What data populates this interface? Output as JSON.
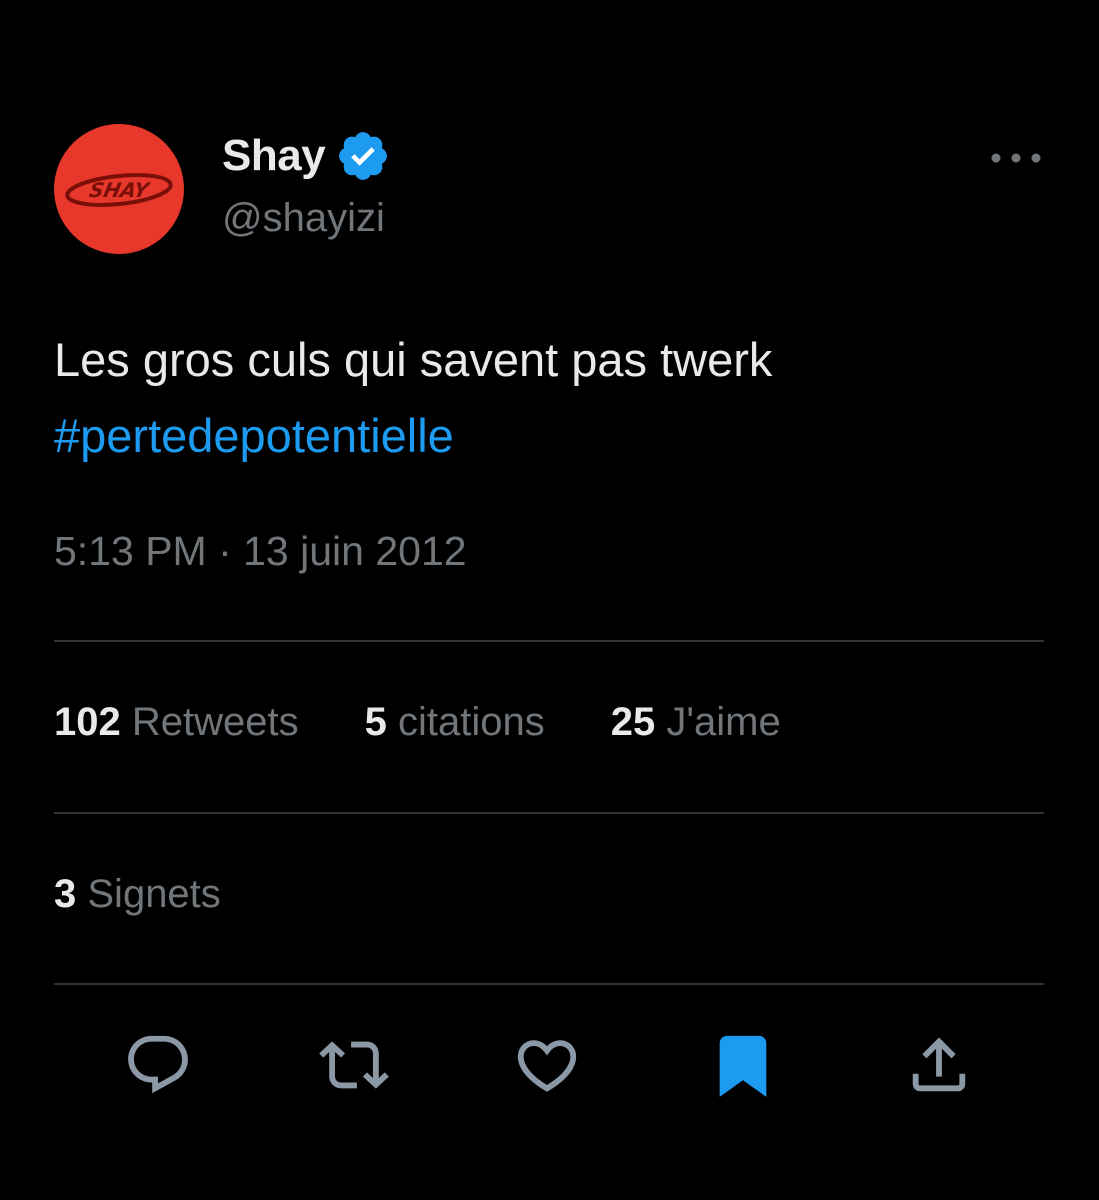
{
  "author": {
    "display_name": "Shay",
    "handle": "@shayizi",
    "verified": true,
    "avatar_logo": "SHAY"
  },
  "tweet": {
    "text": "Les gros culs qui savent pas twerk",
    "hashtag": "#pertedepotentielle",
    "timestamp": "5:13 PM · 13 juin 2012"
  },
  "stats": {
    "retweets": {
      "count": "102",
      "label": "Retweets"
    },
    "quotes": {
      "count": "5",
      "label": "citations"
    },
    "likes": {
      "count": "25",
      "label": "J'aime"
    },
    "bookmarks": {
      "count": "3",
      "label": "Signets"
    }
  },
  "actions": [
    {
      "icon": "reply-icon"
    },
    {
      "icon": "retweet-icon"
    },
    {
      "icon": "like-icon"
    },
    {
      "icon": "bookmark-icon",
      "active": true
    },
    {
      "icon": "share-icon"
    }
  ],
  "colors": {
    "background": "#000000",
    "text": "#e7e9ea",
    "muted": "#71767b",
    "accent": "#1d9bf0",
    "divider": "#2f3336",
    "avatar": "#e8382c",
    "avatar_logo": "#7a0f0a"
  }
}
